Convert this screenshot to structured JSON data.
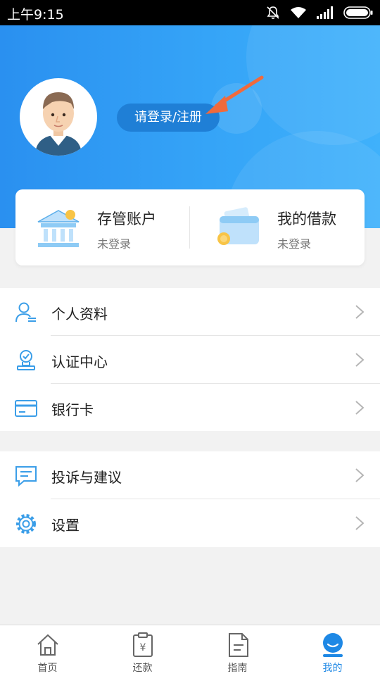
{
  "status_bar": {
    "time": "上午9:15"
  },
  "header": {
    "login_label": "请登录/注册"
  },
  "account_cards": [
    {
      "title": "存管账户",
      "status": "未登录",
      "icon": "bank-icon"
    },
    {
      "title": "我的借款",
      "status": "未登录",
      "icon": "wallet-icon"
    }
  ],
  "menu": {
    "group1": [
      {
        "label": "个人资料",
        "icon": "user-profile-icon"
      },
      {
        "label": "认证中心",
        "icon": "verification-icon"
      },
      {
        "label": "银行卡",
        "icon": "bank-card-icon"
      }
    ],
    "group2": [
      {
        "label": "投诉与建议",
        "icon": "feedback-icon"
      },
      {
        "label": "设置",
        "icon": "gear-icon"
      }
    ]
  },
  "tab_bar": [
    {
      "label": "首页",
      "icon": "home-icon"
    },
    {
      "label": "还款",
      "icon": "repayment-icon"
    },
    {
      "label": "指南",
      "icon": "guide-icon"
    },
    {
      "label": "我的",
      "icon": "me-icon",
      "active": true
    }
  ],
  "colors": {
    "header_blue": "#2a90f0",
    "accent": "#1e88e5",
    "login_button": "#1f7fd6",
    "arrow": "#f06a3c"
  }
}
